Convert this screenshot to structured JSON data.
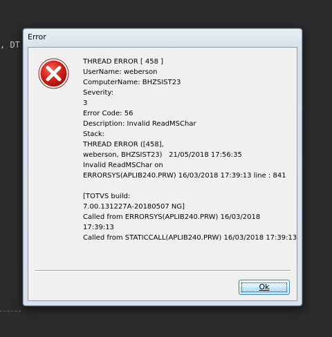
{
  "background": {
    "code_fragment": ", DT"
  },
  "dialog": {
    "title": "Error",
    "icon": "error-x-icon",
    "icon_color": "#cc1b1b",
    "message_lines": [
      "THREAD ERROR [ 458 ]",
      "UserName: weberson",
      "ComputerName: BHZSIST23",
      "Severity:",
      "3",
      "Error Code: 56",
      "Description: Invalid ReadMSChar",
      "Stack:",
      "THREAD ERROR ([458],",
      "weberson, BHZSIST23)   21/05/2018 17:56:35",
      "Invalid ReadMSChar on",
      "ERRORSYS(APLIB240.PRW) 16/03/2018 17:39:13 line : 841",
      "",
      "[TOTVS build:",
      "7.00.131227A-20180507 NG]",
      "Called from ERRORSYS(APLIB240.PRW) 16/03/2018",
      "17:39:13",
      "Called from STATICCALL(APLIB240.PRW) 16/03/2018 17:39:13"
    ],
    "ok_label": "Ok"
  }
}
